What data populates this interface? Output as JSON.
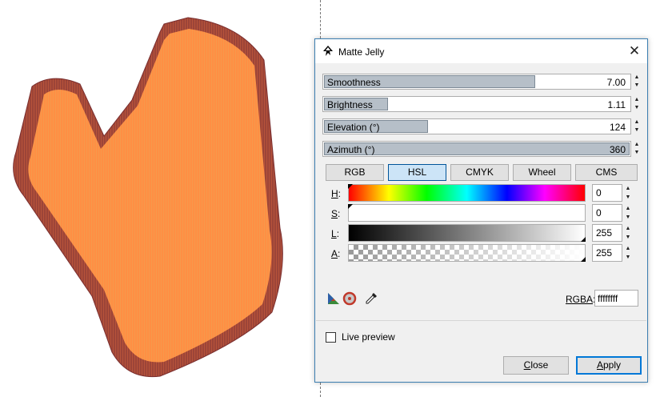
{
  "dialog": {
    "title": "Matte Jelly",
    "close_glyph": "✕"
  },
  "sliders": [
    {
      "label": "Smoothness",
      "value": "7.00",
      "fill_fraction": 0.69
    },
    {
      "label": "Brightness",
      "value": "1.11",
      "fill_fraction": 0.21
    },
    {
      "label": "Elevation (°)",
      "value": "124",
      "fill_fraction": 0.34
    },
    {
      "label": "Azimuth (°)",
      "value": "360",
      "fill_fraction": 1.0
    }
  ],
  "color_tabs": [
    "RGB",
    "HSL",
    "CMYK",
    "Wheel",
    "CMS"
  ],
  "active_color_tab": "HSL",
  "channels": [
    {
      "letter": "H",
      "suffix": ":",
      "value": "0"
    },
    {
      "letter": "S",
      "suffix": ":",
      "value": "0"
    },
    {
      "letter": "L",
      "suffix": ":",
      "value": "255"
    },
    {
      "letter": "A",
      "suffix": ":",
      "value": "255"
    }
  ],
  "rgba": {
    "label_prefix": "RGBA",
    "label_suffix": ":",
    "value": "ffffffff"
  },
  "tools": [
    "color-managed-icon",
    "out-of-gamut-icon",
    "eyedropper-icon"
  ],
  "live_preview": {
    "label": "Live preview",
    "checked": false
  },
  "buttons": {
    "close_letter": "C",
    "close_rest": "lose",
    "apply_letter": "A",
    "apply_rest": "pply"
  },
  "colors": {
    "accent": "#0078d7",
    "shape_fill": "#ff8a3d",
    "shape_border": "#9e4436"
  }
}
